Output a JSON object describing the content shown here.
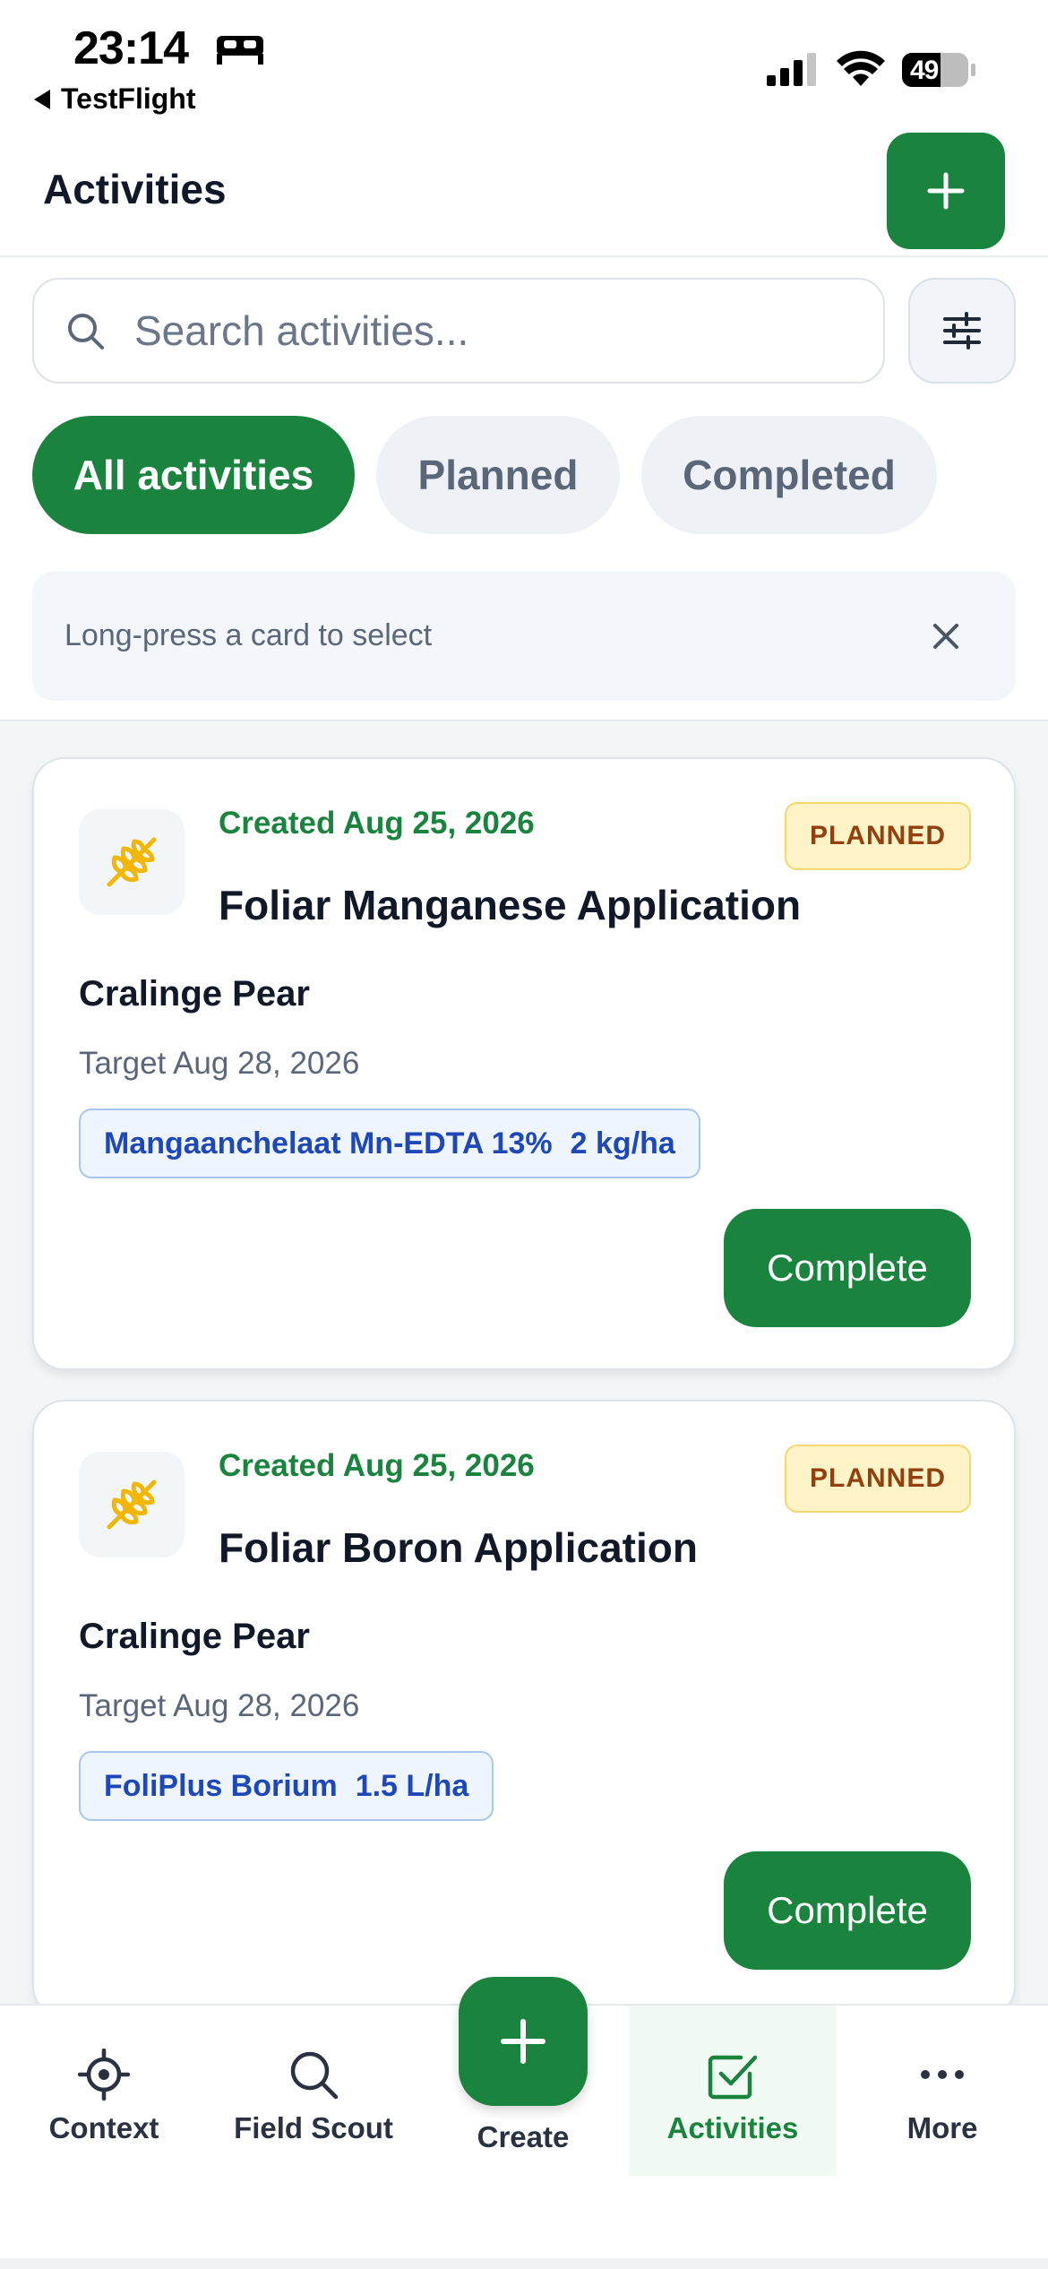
{
  "status_bar": {
    "time": "23:14",
    "back_app": "TestFlight",
    "battery": "49"
  },
  "header": {
    "title": "Activities"
  },
  "search": {
    "placeholder": "Search activities..."
  },
  "tabs": [
    {
      "label": "All activities",
      "active": true
    },
    {
      "label": "Planned",
      "active": false
    },
    {
      "label": "Completed",
      "active": false
    }
  ],
  "hint": {
    "text": "Long-press a card to select"
  },
  "cards": [
    {
      "created": "Created Aug 25, 2026",
      "title": "Foliar Manganese Application",
      "status": "PLANNED",
      "field": "Cralinge Pear",
      "target": "Target Aug 28, 2026",
      "product": "Mangaanchelaat Mn-EDTA 13%",
      "rate": "2 kg/ha",
      "action": "Complete"
    },
    {
      "created": "Created Aug 25, 2026",
      "title": "Foliar Boron Application",
      "status": "PLANNED",
      "field": "Cralinge Pear",
      "target": "Target Aug 28, 2026",
      "product": "FoliPlus Borium",
      "rate": "1.5 L/ha",
      "action": "Complete"
    }
  ],
  "bottom_nav": {
    "context": "Context",
    "field_scout": "Field Scout",
    "create": "Create",
    "activities": "Activities",
    "more": "More"
  },
  "colors": {
    "brand_green": "#1a843f",
    "planned_badge_bg": "#fef4c7",
    "planned_badge_text": "#92400e",
    "chip_blue": "#1e48b8"
  },
  "icons": {
    "crop": "wheat-icon",
    "filter": "sliders-icon",
    "search": "search-icon"
  }
}
